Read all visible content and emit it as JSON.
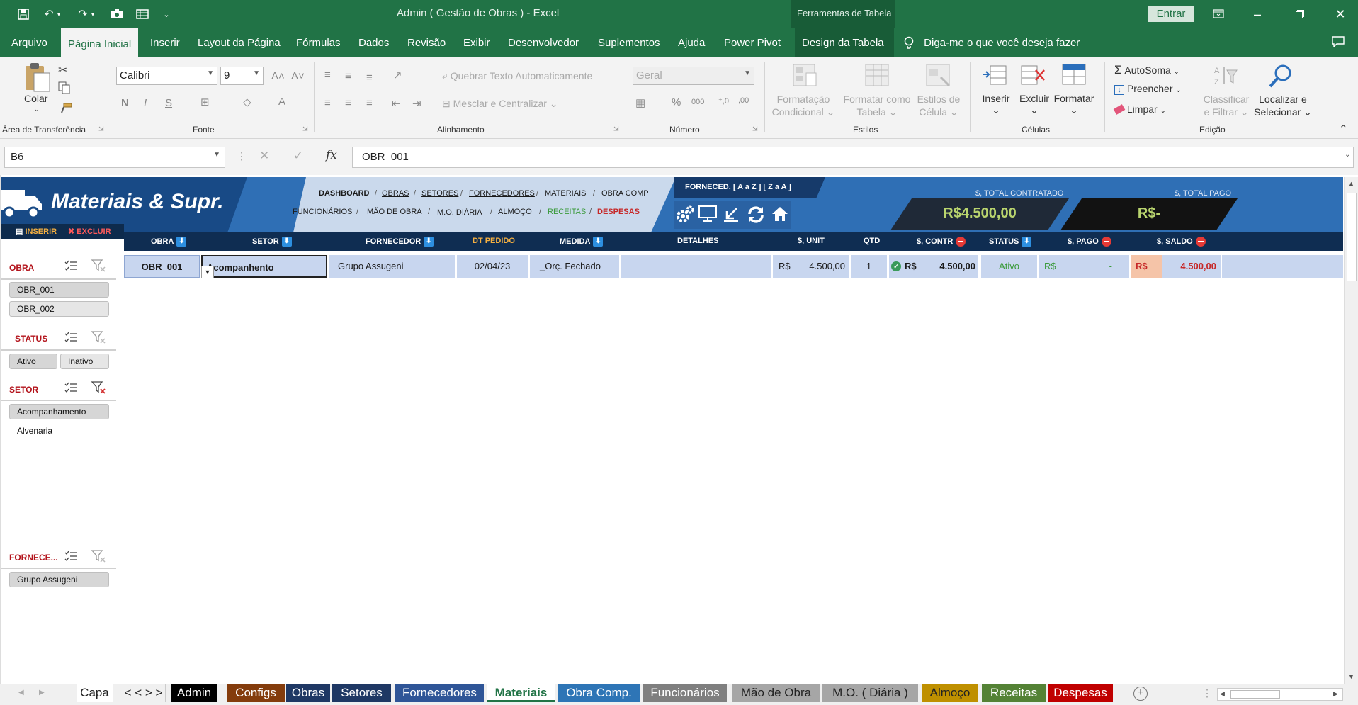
{
  "window": {
    "title": "Admin ( Gestão de Obras )  -  Excel",
    "tools_tab": "Ferramentas de Tabela",
    "signin": "Entrar"
  },
  "ribbon_tabs": [
    "Arquivo",
    "Página Inicial",
    "Inserir",
    "Layout da Página",
    "Fórmulas",
    "Dados",
    "Revisão",
    "Exibir",
    "Desenvolvedor",
    "Suplementos",
    "Ajuda",
    "Power Pivot",
    "Design da Tabela"
  ],
  "tell_me": "Diga-me o que você deseja fazer",
  "ribbon": {
    "clipboard": {
      "paste": "Colar",
      "label": "Área de Transferência"
    },
    "font": {
      "name": "Calibri",
      "size": "9",
      "bold": "N",
      "italic": "I",
      "underline": "S",
      "label": "Fonte"
    },
    "alignment": {
      "wrap": "Quebrar Texto Automaticamente",
      "merge": "Mesclar e Centralizar",
      "label": "Alinhamento"
    },
    "number": {
      "format": "Geral",
      "label": "Número"
    },
    "styles": {
      "conditional": [
        "Formatação",
        "Condicional"
      ],
      "as_table": [
        "Formatar como",
        "Tabela"
      ],
      "cell_styles": [
        "Estilos de",
        "Célula"
      ],
      "label": "Estilos"
    },
    "cells": {
      "insert": "Inserir",
      "delete": "Excluir",
      "format": "Formatar",
      "label": "Células"
    },
    "editing": {
      "autosum": "AutoSoma",
      "fill": "Preencher",
      "clear": "Limpar",
      "sort": [
        "Classificar",
        "e Filtrar"
      ],
      "find": [
        "Localizar e",
        "Selecionar"
      ],
      "label": "Edição"
    }
  },
  "formula_bar": {
    "name_box": "B6",
    "formula": "OBR_001"
  },
  "sheet": {
    "title": "Materiais & Supr.",
    "insert_btn": "INSERIR",
    "delete_btn": "EXCLUIR",
    "nav_row1": [
      "DASHBOARD",
      "OBRAS",
      "SETORES",
      "FORNECEDORES",
      "MATERIAIS",
      "OBRA COMP"
    ],
    "nav_row2": [
      "FUNCIONÁRIOS",
      "MÃO DE OBRA",
      "M.O. DIÁRIA",
      "ALMOÇO",
      "RECEITAS",
      "DESPESAS"
    ],
    "supplier_sort": "FORNECED.  [ A a Z ] [ Z a A ]",
    "total_contracted_label": "$, TOTAL CONTRATADO",
    "total_contracted_value": "R$4.500,00",
    "total_paid_label": "$, TOTAL PAGO",
    "total_paid_value": "R$-",
    "headers": [
      "OBRA",
      "SETOR",
      "FORNECEDOR",
      "DT PEDIDO",
      "MEDIDA",
      "DETALHES",
      "$, UNIT",
      "QTD",
      "$, CONTR",
      "STATUS",
      "$, PAGO",
      "$, SALDO"
    ],
    "row": {
      "obra": "OBR_001",
      "setor": "Acompanhento",
      "fornecedor": "Grupo Assugeni",
      "dt_pedido": "02/04/23",
      "medida": "_Orç. Fechado",
      "detalhes": "",
      "unit_cur": "R$",
      "unit": "4.500,00",
      "qtd": "1",
      "contr_cur": "R$",
      "contr": "4.500,00",
      "status": "Ativo",
      "pago_cur": "R$",
      "pago": "-",
      "saldo_cur": "R$",
      "saldo": "4.500,00"
    },
    "slicers": {
      "obra": {
        "title": "OBRA",
        "items": [
          "OBR_001",
          "OBR_002"
        ]
      },
      "status": {
        "title": "STATUS",
        "items": [
          "Ativo",
          "Inativo"
        ]
      },
      "setor": {
        "title": "SETOR",
        "items": [
          "Acompanhamento",
          "Alvenaria"
        ]
      },
      "fornecedor": {
        "title": "FORNECE...",
        "items": [
          "Grupo Assugeni"
        ]
      }
    }
  },
  "sheet_tabs": [
    {
      "name": "Capa",
      "color": "#ffffff",
      "text": "#222222"
    },
    {
      "name": "< < > >",
      "color": "#f0f0f0",
      "text": "#222222"
    },
    {
      "name": "Admin",
      "color": "#000000",
      "text": "#ffffff"
    },
    {
      "name": "Configs",
      "color": "#843c0c",
      "text": "#ffffff"
    },
    {
      "name": "Obras",
      "color": "#1f3864",
      "text": "#ffffff"
    },
    {
      "name": "Setores",
      "color": "#1f3864",
      "text": "#ffffff"
    },
    {
      "name": "Fornecedores",
      "color": "#2f5597",
      "text": "#ffffff"
    },
    {
      "name": "Materiais",
      "color": "#ffffff",
      "text": "#217346"
    },
    {
      "name": "Obra Comp.",
      "color": "#2e75b6",
      "text": "#ffffff"
    },
    {
      "name": "Funcionários",
      "color": "#7f7f7f",
      "text": "#ffffff"
    },
    {
      "name": "Mão de Obra",
      "color": "#a6a6a6",
      "text": "#222222"
    },
    {
      "name": "M.O. ( Diária )",
      "color": "#a6a6a6",
      "text": "#222222"
    },
    {
      "name": "Almoço",
      "color": "#bf9000",
      "text": "#222222"
    },
    {
      "name": "Receitas",
      "color": "#548235",
      "text": "#ffffff"
    },
    {
      "name": "Despesas",
      "color": "#c00000",
      "text": "#ffffff"
    }
  ],
  "colors": {
    "excel_green": "#217346",
    "banner_blue": "#2f6fb5",
    "header_navy": "#0f2d52",
    "row_fill": "#c8d6ef",
    "accent_red": "#b3131b"
  }
}
